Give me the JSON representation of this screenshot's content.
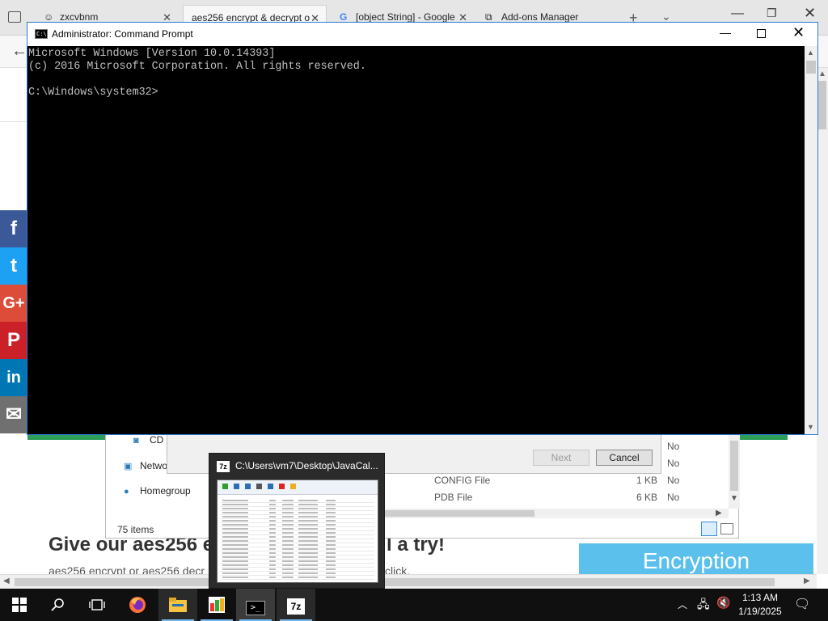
{
  "browser": {
    "tabs": [
      {
        "label": "zxcvbnm",
        "icon": "emoji-face-icon"
      },
      {
        "label": "aes256 encrypt & decrypt o",
        "icon": "none"
      },
      {
        "label": "[object String] - Google",
        "icon": "google-g-icon"
      },
      {
        "label": "Add-ons Manager",
        "icon": "puzzle-piece-icon"
      }
    ],
    "tab_close_glyph": "✕",
    "new_tab_glyph": "+",
    "tab_list_glyph": "⌄"
  },
  "page": {
    "headline": "Give our aes256 e",
    "headline_tail": "l a try!",
    "subline": "aes256 encrypt or aes256 decr",
    "subline_tail": "click.",
    "encryption_button": "Encryption",
    "social": [
      "f",
      "t",
      "G+",
      "P",
      "in",
      "✉"
    ],
    "accent_green": "#2e9e5b",
    "accent_blue": "#5bc0eb"
  },
  "explorer": {
    "nav": [
      {
        "label": "CD D",
        "icon": "cd-drive-icon"
      },
      {
        "label": "Netwo",
        "icon": "network-icon"
      },
      {
        "label": "Homegroup",
        "icon": "homegroup-icon"
      }
    ],
    "items_count": "75 items",
    "files": [
      {
        "type": "CONFIG File",
        "size": "1 KB"
      },
      {
        "type": "PDB File",
        "size": "6 KB"
      }
    ],
    "column_values": [
      "No",
      "No",
      "No",
      "No"
    ]
  },
  "wizard": {
    "next": "Next",
    "cancel": "Cancel"
  },
  "cmd": {
    "title": "Administrator: Command Prompt",
    "icon_text": "C:\\",
    "lines": [
      "Microsoft Windows [Version 10.0.14393]",
      "(c) 2016 Microsoft Corporation. All rights reserved.",
      "",
      "C:\\Windows\\system32>"
    ]
  },
  "thumbnail": {
    "title": "C:\\Users\\vm7\\Desktop\\JavaCal...",
    "icon_text": "7z"
  },
  "taskbar": {
    "time": "1:13 AM",
    "date": "1/19/2025",
    "cmd_icon_text": ">_",
    "sevenzip_text": "7z"
  }
}
